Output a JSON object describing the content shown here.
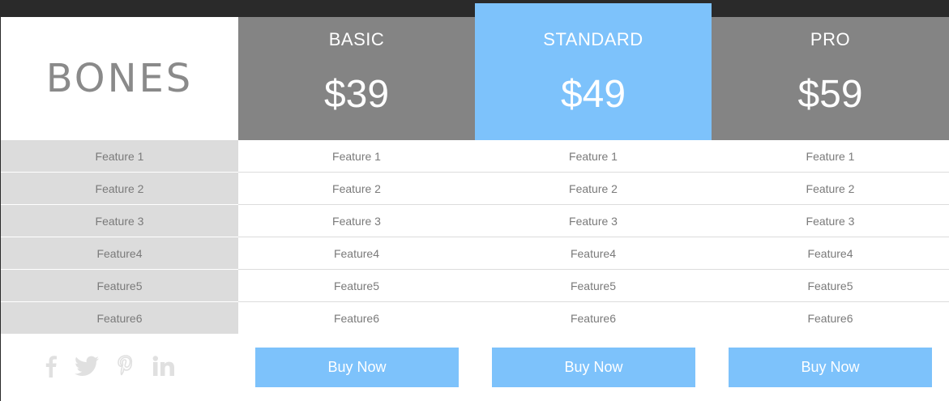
{
  "logo": {
    "text": "BONES"
  },
  "plans": [
    {
      "name": "BASIC",
      "price": "$39",
      "button": "Buy Now"
    },
    {
      "name": "STANDARD",
      "price": "$49",
      "button": "Buy Now"
    },
    {
      "name": "PRO",
      "price": "$59",
      "button": "Buy Now"
    }
  ],
  "features": [
    "Feature 1",
    "Feature 2",
    "Feature 3",
    "Feature4",
    "Feature5",
    "Feature6"
  ],
  "social": [
    "facebook-icon",
    "twitter-icon",
    "pinterest-icon",
    "linkedin-icon"
  ],
  "colors": {
    "accent": "#7dc2fb",
    "header_gray": "#848484",
    "label_gray": "#dcdcdc",
    "topbar": "#2a2a2a"
  }
}
